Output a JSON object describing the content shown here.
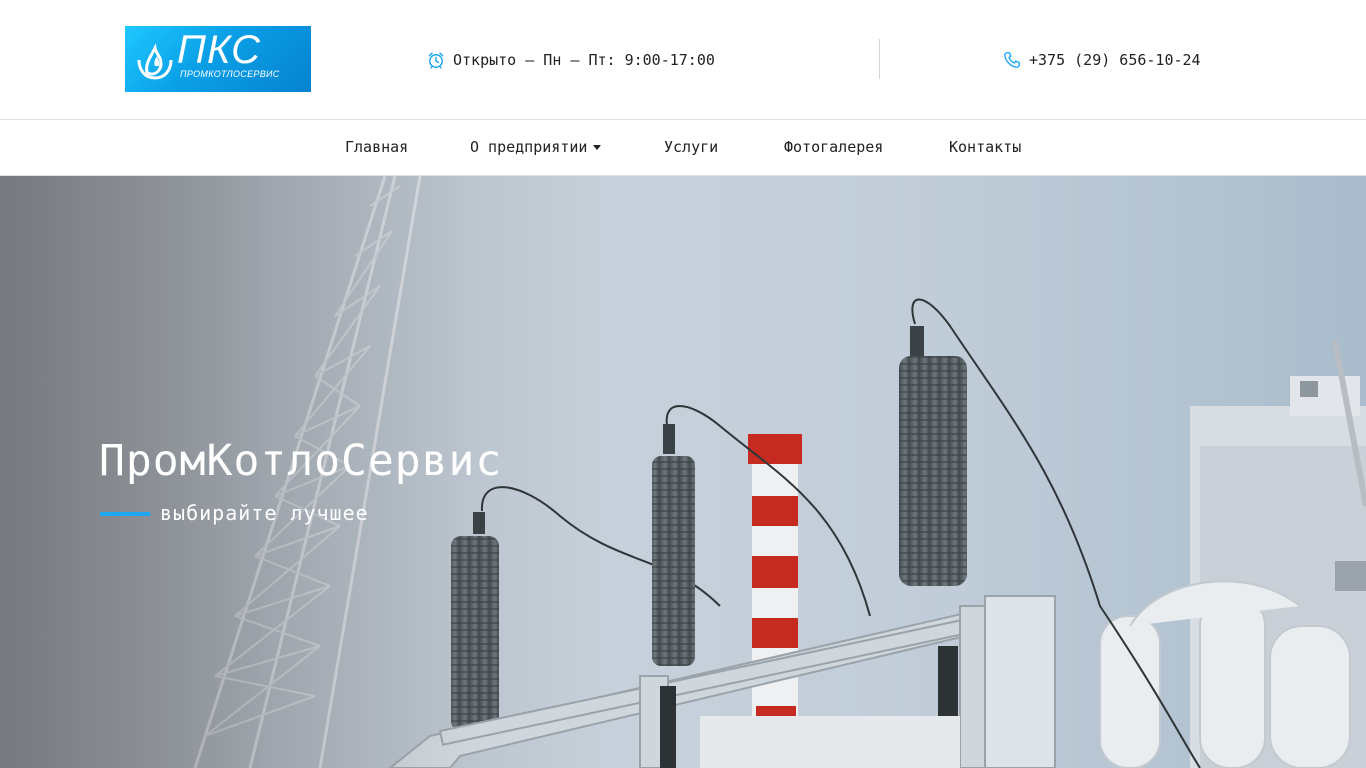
{
  "header": {
    "logo": {
      "text": "ПКС",
      "subtitle": "ПРОМКОТЛОСЕРВИС"
    },
    "hours": {
      "icon": "alarm-clock-icon",
      "text": "Открыто – Пн – Пт: 9:00-17:00"
    },
    "phone": {
      "icon": "phone-icon",
      "text": "+375 (29) 656-10-24"
    }
  },
  "nav": {
    "items": [
      {
        "label": "Главная"
      },
      {
        "label": "О предприятии",
        "dropdown": true
      },
      {
        "label": "Услуги"
      },
      {
        "label": "Фотогалерея"
      },
      {
        "label": "Контакты"
      }
    ]
  },
  "hero": {
    "title": "ПромКотлоСервис",
    "subtitle": "выбирайте лучшее"
  },
  "colors": {
    "accent": "#1ea7f2",
    "logo_blue": "#0a9fe6",
    "text": "#222222"
  }
}
